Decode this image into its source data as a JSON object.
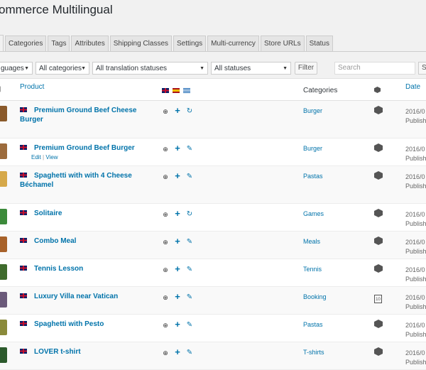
{
  "page": {
    "title": "ommerce Multilingual"
  },
  "tabs": [
    "s",
    "Categories",
    "Tags",
    "Attributes",
    "Shipping Classes",
    "Settings",
    "Multi-currency",
    "Store URLs",
    "Status"
  ],
  "filters": {
    "languages": "guages",
    "categories": "All categories",
    "translation_statuses": "All translation statuses",
    "statuses": "All statuses",
    "filter_button": "Filter",
    "search_placeholder": "Search",
    "search_button": "S"
  },
  "table": {
    "header_product": "Product",
    "header_categories": "Categories",
    "header_date": "Date",
    "language_flags": [
      "en",
      "es",
      "el"
    ]
  },
  "rows": [
    {
      "name": "Premium Ground Beef Cheese Burger",
      "category": "Burger",
      "date": "2016/0",
      "status": "Publish",
      "action": "refresh",
      "type": "simple",
      "thumb": "#8a5a2b",
      "actions": ""
    },
    {
      "name": "Premium Ground Beef Burger",
      "category": "Burger",
      "date": "2016/0",
      "status": "Publish",
      "action": "edit",
      "type": "simple",
      "thumb": "#9c6b3c",
      "actions": "yes"
    },
    {
      "name": "Spaghetti with with 4 Cheese Béchamel",
      "category": "Pastas",
      "date": "2016/0",
      "status": "Publish",
      "action": "edit",
      "type": "simple",
      "thumb": "#d6a94a",
      "actions": ""
    },
    {
      "name": "Solitaire",
      "category": "Games",
      "date": "2016/0",
      "status": "Publish",
      "action": "refresh",
      "type": "simple",
      "thumb": "#3c8a3a",
      "actions": ""
    },
    {
      "name": "Combo Meal",
      "category": "Meals",
      "date": "2016/0",
      "status": "Publish",
      "action": "edit",
      "type": "simple",
      "thumb": "#a8622a",
      "actions": ""
    },
    {
      "name": "Tennis Lesson",
      "category": "Tennis",
      "date": "2016/0",
      "status": "Publish",
      "action": "edit",
      "type": "simple",
      "thumb": "#3f6b2c",
      "actions": ""
    },
    {
      "name": "Luxury Villa near Vatican",
      "category": "Booking",
      "date": "2016/0",
      "status": "Publish",
      "action": "edit",
      "type": "booking",
      "thumb": "#6b5a7a",
      "actions": ""
    },
    {
      "name": "Spaghetti with Pesto",
      "category": "Pastas",
      "date": "2016/0",
      "status": "Publish",
      "action": "edit",
      "type": "simple",
      "thumb": "#8a8a3a",
      "actions": ""
    },
    {
      "name": "LOVER t-shirt",
      "category": "T-shirts",
      "date": "2016/0",
      "status": "Publish",
      "action": "edit",
      "type": "simple",
      "thumb": "#2c5a2c",
      "actions": ""
    }
  ],
  "row_actions": {
    "edit": "Edit",
    "view": "View",
    "sep": "|"
  },
  "booking_icon_text": "10"
}
